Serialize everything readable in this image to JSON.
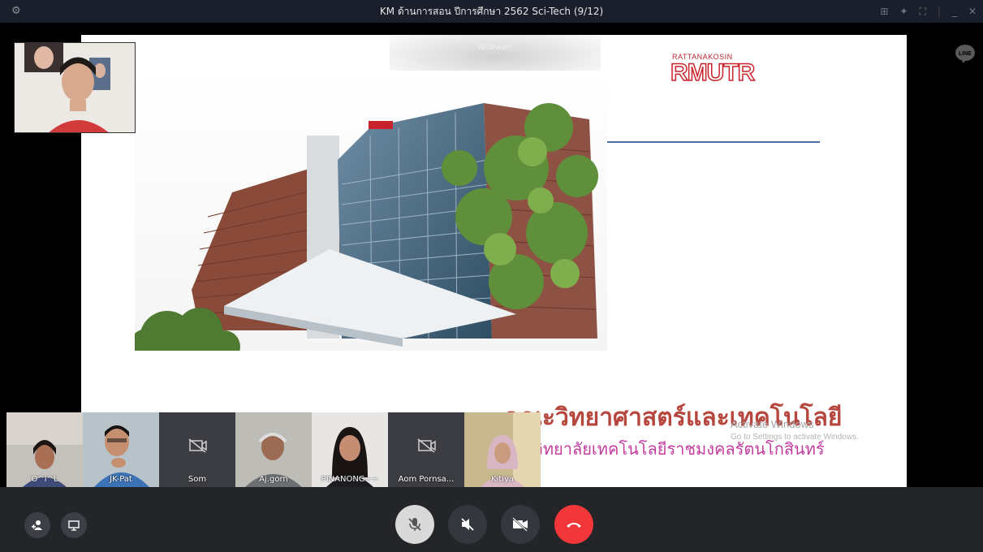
{
  "window": {
    "title": "KM ด้านการสอน ปีการศึกษา 2562 Sci-Tech (9/12)"
  },
  "presenter": {
    "name": "Wilawan"
  },
  "slide": {
    "logo_small": "RATTANAKOSIN",
    "logo_big": "RMUTR",
    "heading": "คณะวิทยาศาสตร์และเทคโนโลยี",
    "subheading": "มหาวิทยาลัยเทคโนโลยีราชมงคลรัตนโกสินทร์",
    "watermark_title": "Activate Windows",
    "watermark_sub": "Go to Settings to activate Windows."
  },
  "participants": [
    {
      "name": "O^i^L",
      "camera": "on"
    },
    {
      "name": "JK-Pat",
      "camera": "on"
    },
    {
      "name": "Som",
      "camera": "off"
    },
    {
      "name": "Aj.gorn",
      "camera": "on"
    },
    {
      "name": "PINANONG~~",
      "camera": "on"
    },
    {
      "name": "Aom Pornsa...",
      "camera": "off"
    },
    {
      "name": "Kitiya",
      "camera": "on"
    }
  ],
  "colors": {
    "call_end": "#f2373a",
    "logo_red": "#c8232a",
    "heading": "#b5473e",
    "subheading": "#c33d9e",
    "line_app": "#5a5a5a"
  },
  "controls": {
    "left": [
      "add-participant-icon",
      "screen-share-icon"
    ],
    "center": [
      "microphone-muted-icon",
      "speaker-muted-icon",
      "camera-off-icon",
      "end-call-icon"
    ]
  },
  "line_badge": "LINE"
}
